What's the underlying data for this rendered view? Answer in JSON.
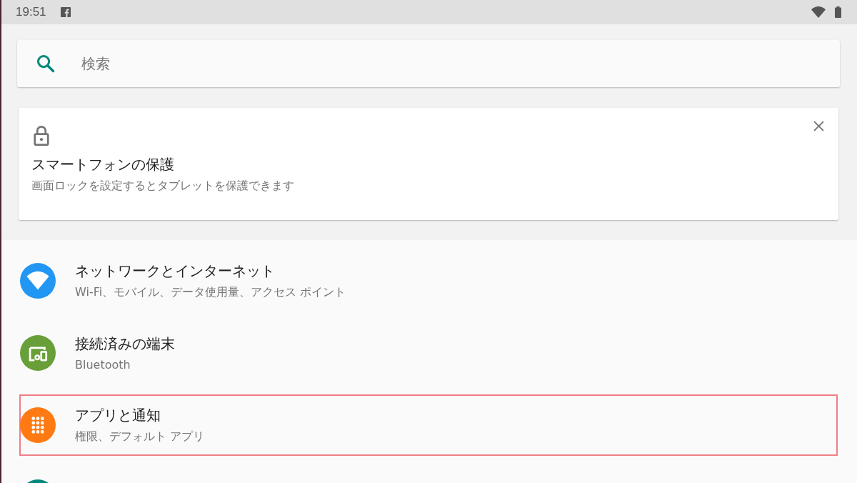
{
  "status_bar": {
    "time": "19:51"
  },
  "search": {
    "placeholder": "検索"
  },
  "suggestion_card": {
    "title": "スマートフォンの保護",
    "subtitle": "画面ロックを設定するとタブレットを保護できます"
  },
  "settings": [
    {
      "title": "ネットワークとインターネット",
      "subtitle": "Wi-Fi、モバイル、データ使用量、アクセス ポイント",
      "color": "#2196f3",
      "highlighted": false
    },
    {
      "title": "接続済みの端末",
      "subtitle": "Bluetooth",
      "color": "#689f38",
      "highlighted": false
    },
    {
      "title": "アプリと通知",
      "subtitle": "権限、デフォルト アプリ",
      "color": "#ff7a12",
      "highlighted": true
    },
    {
      "color": "#00897b",
      "highlighted": false
    }
  ]
}
